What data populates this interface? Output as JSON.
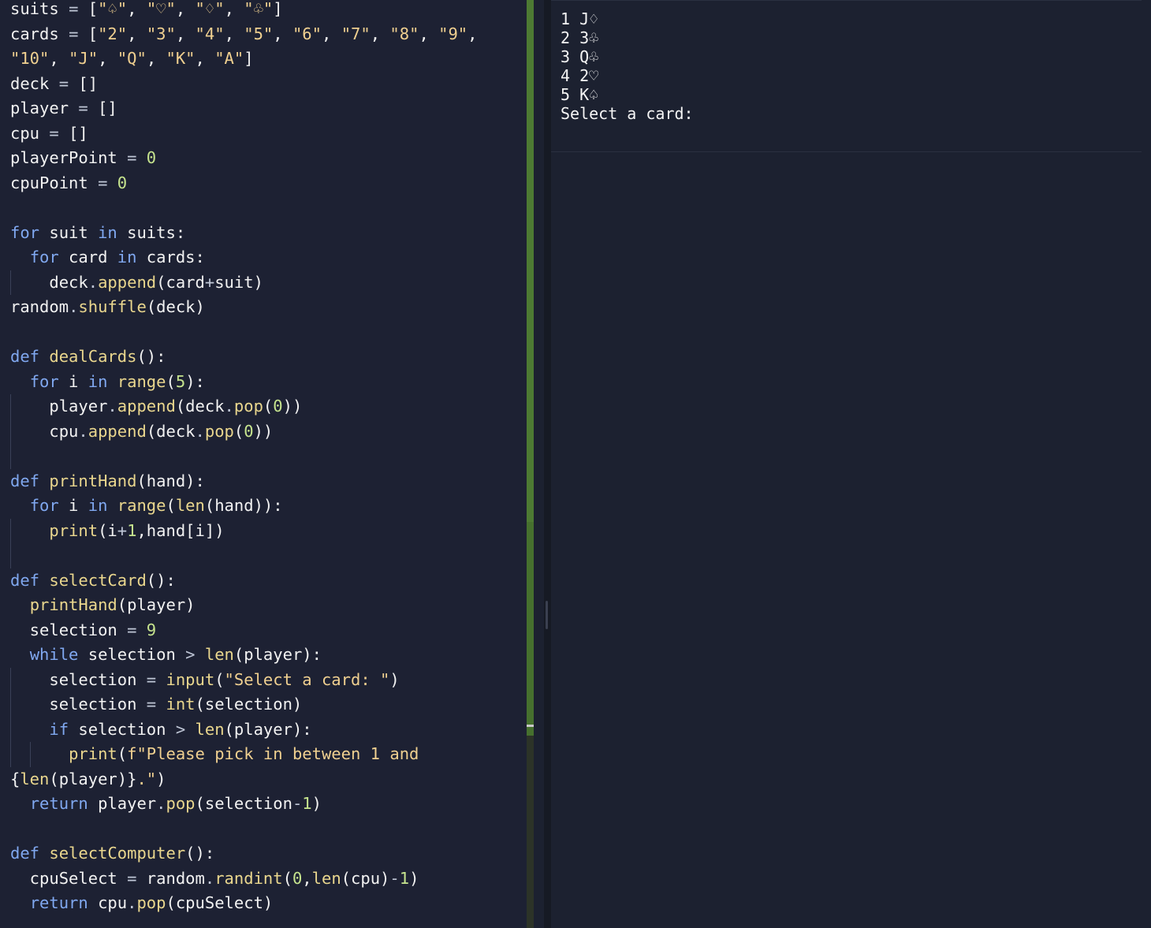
{
  "editor": {
    "lines": [
      [
        [
          "ws",
          "suits "
        ],
        [
          "op",
          "= "
        ],
        [
          "ws",
          "["
        ],
        [
          "str",
          "\"♤\""
        ],
        [
          "ws",
          ", "
        ],
        [
          "str",
          "\"♡\""
        ],
        [
          "ws",
          ", "
        ],
        [
          "str",
          "\"♢\""
        ],
        [
          "ws",
          ", "
        ],
        [
          "str",
          "\"♧\""
        ],
        [
          "ws",
          "]"
        ]
      ],
      [
        [
          "ws",
          "cards "
        ],
        [
          "op",
          "= "
        ],
        [
          "ws",
          "["
        ],
        [
          "str",
          "\"2\""
        ],
        [
          "ws",
          ", "
        ],
        [
          "str",
          "\"3\""
        ],
        [
          "ws",
          ", "
        ],
        [
          "str",
          "\"4\""
        ],
        [
          "ws",
          ", "
        ],
        [
          "str",
          "\"5\""
        ],
        [
          "ws",
          ", "
        ],
        [
          "str",
          "\"6\""
        ],
        [
          "ws",
          ", "
        ],
        [
          "str",
          "\"7\""
        ],
        [
          "ws",
          ", "
        ],
        [
          "str",
          "\"8\""
        ],
        [
          "ws",
          ", "
        ],
        [
          "str",
          "\"9\""
        ],
        [
          "ws",
          ","
        ]
      ],
      [
        [
          "str",
          "\"10\""
        ],
        [
          "ws",
          ", "
        ],
        [
          "str",
          "\"J\""
        ],
        [
          "ws",
          ", "
        ],
        [
          "str",
          "\"Q\""
        ],
        [
          "ws",
          ", "
        ],
        [
          "str",
          "\"K\""
        ],
        [
          "ws",
          ", "
        ],
        [
          "str",
          "\"A\""
        ],
        [
          "ws",
          "]"
        ]
      ],
      [
        [
          "ws",
          "deck "
        ],
        [
          "op",
          "= "
        ],
        [
          "ws",
          "[]"
        ]
      ],
      [
        [
          "ws",
          "player "
        ],
        [
          "op",
          "= "
        ],
        [
          "ws",
          "[]"
        ]
      ],
      [
        [
          "ws",
          "cpu "
        ],
        [
          "op",
          "= "
        ],
        [
          "ws",
          "[]"
        ]
      ],
      [
        [
          "ws",
          "playerPoint "
        ],
        [
          "op",
          "= "
        ],
        [
          "num",
          "0"
        ]
      ],
      [
        [
          "ws",
          "cpuPoint "
        ],
        [
          "op",
          "= "
        ],
        [
          "num",
          "0"
        ]
      ],
      [],
      [
        [
          "kw",
          "for"
        ],
        [
          "ws",
          " suit "
        ],
        [
          "kw",
          "in"
        ],
        [
          "ws",
          " suits:"
        ]
      ],
      [
        [
          "ws",
          "  "
        ],
        [
          "kw",
          "for"
        ],
        [
          "ws",
          " card "
        ],
        [
          "kw",
          "in"
        ],
        [
          "ws",
          " cards:"
        ]
      ],
      [
        [
          "ws",
          "    deck"
        ],
        [
          "op",
          "."
        ],
        [
          "fn",
          "append"
        ],
        [
          "ws",
          "(card"
        ],
        [
          "op",
          "+"
        ],
        [
          "ws",
          "suit)"
        ]
      ],
      [
        [
          "ws",
          "random"
        ],
        [
          "op",
          "."
        ],
        [
          "fn",
          "shuffle"
        ],
        [
          "ws",
          "(deck)"
        ]
      ],
      [],
      [
        [
          "kw",
          "def"
        ],
        [
          "ws",
          " "
        ],
        [
          "fn",
          "dealCards"
        ],
        [
          "ws",
          "():"
        ]
      ],
      [
        [
          "ws",
          "  "
        ],
        [
          "kw",
          "for"
        ],
        [
          "ws",
          " i "
        ],
        [
          "kw",
          "in"
        ],
        [
          "ws",
          " "
        ],
        [
          "fn",
          "range"
        ],
        [
          "ws",
          "("
        ],
        [
          "num",
          "5"
        ],
        [
          "ws",
          "):"
        ]
      ],
      [
        [
          "ws",
          "    player"
        ],
        [
          "op",
          "."
        ],
        [
          "fn",
          "append"
        ],
        [
          "ws",
          "(deck"
        ],
        [
          "op",
          "."
        ],
        [
          "fn",
          "pop"
        ],
        [
          "ws",
          "("
        ],
        [
          "num",
          "0"
        ],
        [
          "ws",
          "))"
        ]
      ],
      [
        [
          "ws",
          "    cpu"
        ],
        [
          "op",
          "."
        ],
        [
          "fn",
          "append"
        ],
        [
          "ws",
          "(deck"
        ],
        [
          "op",
          "."
        ],
        [
          "fn",
          "pop"
        ],
        [
          "ws",
          "("
        ],
        [
          "num",
          "0"
        ],
        [
          "ws",
          "))"
        ]
      ],
      [],
      [
        [
          "kw",
          "def"
        ],
        [
          "ws",
          " "
        ],
        [
          "fn",
          "printHand"
        ],
        [
          "ws",
          "(hand):"
        ]
      ],
      [
        [
          "ws",
          "  "
        ],
        [
          "kw",
          "for"
        ],
        [
          "ws",
          " i "
        ],
        [
          "kw",
          "in"
        ],
        [
          "ws",
          " "
        ],
        [
          "fn",
          "range"
        ],
        [
          "ws",
          "("
        ],
        [
          "fn",
          "len"
        ],
        [
          "ws",
          "(hand)):"
        ]
      ],
      [
        [
          "ws",
          "    "
        ],
        [
          "fn",
          "print"
        ],
        [
          "ws",
          "(i"
        ],
        [
          "op",
          "+"
        ],
        [
          "num",
          "1"
        ],
        [
          "ws",
          ",hand[i])"
        ]
      ],
      [],
      [
        [
          "kw",
          "def"
        ],
        [
          "ws",
          " "
        ],
        [
          "fn",
          "selectCard"
        ],
        [
          "ws",
          "():"
        ]
      ],
      [
        [
          "ws",
          "  "
        ],
        [
          "fn",
          "printHand"
        ],
        [
          "ws",
          "(player)"
        ]
      ],
      [
        [
          "ws",
          "  selection "
        ],
        [
          "op",
          "= "
        ],
        [
          "num",
          "9"
        ]
      ],
      [
        [
          "ws",
          "  "
        ],
        [
          "kw",
          "while"
        ],
        [
          "ws",
          " selection "
        ],
        [
          "op",
          ">"
        ],
        [
          "ws",
          " "
        ],
        [
          "fn",
          "len"
        ],
        [
          "ws",
          "(player):"
        ]
      ],
      [
        [
          "ws",
          "    selection "
        ],
        [
          "op",
          "="
        ],
        [
          "ws",
          " "
        ],
        [
          "fn",
          "input"
        ],
        [
          "ws",
          "("
        ],
        [
          "str",
          "\"Select a card: \""
        ],
        [
          "ws",
          ")"
        ]
      ],
      [
        [
          "ws",
          "    selection "
        ],
        [
          "op",
          "="
        ],
        [
          "ws",
          " "
        ],
        [
          "fn",
          "int"
        ],
        [
          "ws",
          "(selection)"
        ]
      ],
      [
        [
          "ws",
          "    "
        ],
        [
          "kw",
          "if"
        ],
        [
          "ws",
          " selection "
        ],
        [
          "op",
          ">"
        ],
        [
          "ws",
          " "
        ],
        [
          "fn",
          "len"
        ],
        [
          "ws",
          "(player):"
        ]
      ],
      [
        [
          "ws",
          "      "
        ],
        [
          "fn",
          "print"
        ],
        [
          "ws",
          "("
        ],
        [
          "str",
          "f\"Please pick in between 1 and"
        ]
      ],
      [
        [
          "ws",
          "{"
        ],
        [
          "fn",
          "len"
        ],
        [
          "ws",
          "(player)}"
        ],
        [
          "str",
          ".\""
        ],
        [
          "ws",
          ")"
        ]
      ],
      [
        [
          "ws",
          "  "
        ],
        [
          "kw",
          "return"
        ],
        [
          "ws",
          " player"
        ],
        [
          "op",
          "."
        ],
        [
          "fn",
          "pop"
        ],
        [
          "ws",
          "(selection"
        ],
        [
          "op",
          "-"
        ],
        [
          "num",
          "1"
        ],
        [
          "ws",
          ")"
        ]
      ],
      [],
      [
        [
          "kw",
          "def"
        ],
        [
          "ws",
          " "
        ],
        [
          "fn",
          "selectComputer"
        ],
        [
          "ws",
          "():"
        ]
      ],
      [
        [
          "ws",
          "  cpuSelect "
        ],
        [
          "op",
          "="
        ],
        [
          "ws",
          " random"
        ],
        [
          "op",
          "."
        ],
        [
          "fn",
          "randint"
        ],
        [
          "ws",
          "("
        ],
        [
          "num",
          "0"
        ],
        [
          "ws",
          ","
        ],
        [
          "fn",
          "len"
        ],
        [
          "ws",
          "(cpu)"
        ],
        [
          "op",
          "-"
        ],
        [
          "num",
          "1"
        ],
        [
          "ws",
          ")"
        ]
      ],
      [
        [
          "ws",
          "  "
        ],
        [
          "kw",
          "return"
        ],
        [
          "ws",
          " cpu"
        ],
        [
          "op",
          "."
        ],
        [
          "fn",
          "pop"
        ],
        [
          "ws",
          "(cpuSelect)"
        ]
      ]
    ]
  },
  "console": {
    "output_lines": [
      "1 J♢",
      "2 3♧",
      "3 Q♧",
      "4 2♡",
      "5 K♤",
      "Select a card: "
    ]
  },
  "colors": {
    "editor_bg": "#1d2133",
    "console_bg": "#1c2130",
    "keyword": "#80a8f0",
    "function": "#ead78e",
    "string": "#f0d090",
    "number": "#c6e48e",
    "scrollbar_thumb": "#46702e"
  }
}
